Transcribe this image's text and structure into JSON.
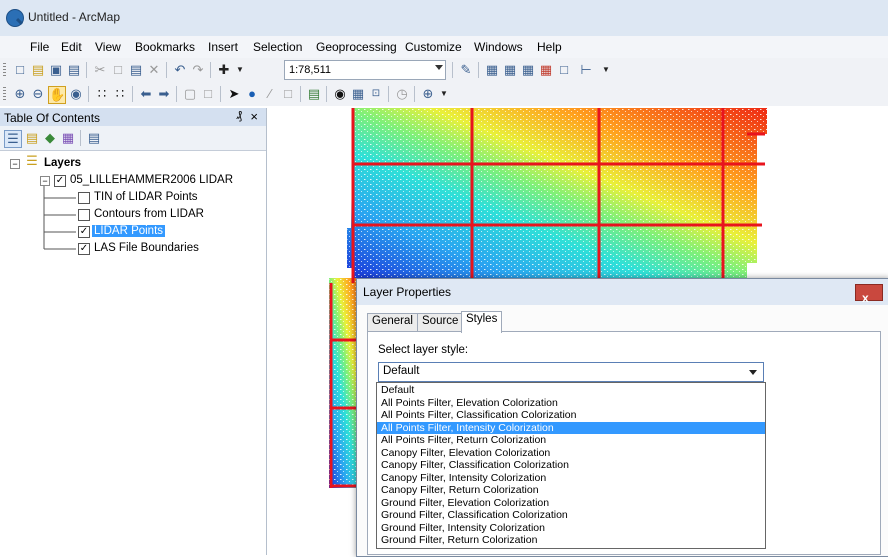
{
  "window": {
    "title": "Untitled - ArcMap"
  },
  "menu": [
    "File",
    "Edit",
    "View",
    "Bookmarks",
    "Insert",
    "Selection",
    "Geoprocessing",
    "Customize",
    "Windows",
    "Help"
  ],
  "toolbar": {
    "scale": "1:78,511"
  },
  "toc": {
    "title": "Table Of Contents",
    "pin": "&#x1F4CC;",
    "tree": {
      "root": "Layers",
      "group": "05_LILLEHAMMER2006 LIDAR",
      "items": [
        {
          "label": "TIN of LIDAR Points",
          "checked": false,
          "selected": false
        },
        {
          "label": "Contours from LIDAR",
          "checked": false,
          "selected": false
        },
        {
          "label": "LIDAR Points",
          "checked": true,
          "selected": true
        },
        {
          "label": "LAS File Boundaries",
          "checked": true,
          "selected": false
        }
      ]
    }
  },
  "dialog": {
    "title": "Layer Properties",
    "close": "x",
    "tabs": [
      "General",
      "Source",
      "Styles"
    ],
    "active_tab": "Styles",
    "style_label": "Select layer style:",
    "selected_style": "Default",
    "highlighted_option": "All Points Filter, Intensity Colorization",
    "options": [
      "Default",
      "All Points Filter, Elevation Colorization",
      "All Points Filter, Classification Colorization",
      "All Points Filter, Intensity Colorization",
      "All Points Filter, Return Colorization",
      "Canopy Filter, Elevation Colorization",
      "Canopy Filter, Classification Colorization",
      "Canopy Filter, Intensity Colorization",
      "Canopy Filter, Return Colorization",
      "Ground Filter, Elevation Colorization",
      "Ground Filter, Classification Colorization",
      "Ground Filter, Intensity Colorization",
      "Ground Filter, Return Colorization"
    ]
  },
  "colors": {
    "boundary": "#e8141e",
    "selection": "#3399ff"
  }
}
